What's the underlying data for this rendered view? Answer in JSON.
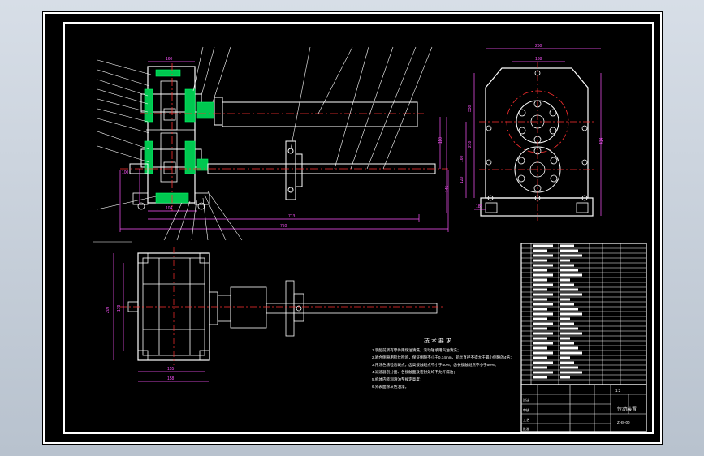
{
  "drawing": {
    "dimensions": {
      "gearbox_width_top": "160",
      "shaft_length": "713",
      "overall_length": "750",
      "base_width": "158",
      "side_width_top": "260",
      "side_width_inner": "168",
      "side_height": "414",
      "plan_width": "209",
      "plan_width_inner": "179",
      "plan_depth": "155",
      "side_offset": "185",
      "side_h1": "330",
      "side_h2": "210",
      "side_h3": "160",
      "side_h4": "120",
      "dim_110": "110",
      "dim_145": "145",
      "dim_100": "100",
      "gearbox_bottom": "104"
    },
    "tech_req_title": "技 术 要 求",
    "tech_req_lines": [
      "1.装配前所有零件用煤油清洗，滚动轴承用汽油清洗；",
      "2.啮合侧隙用铅丝检验，保证侧隙不小于0.14mm，铅丝直径不得大于最小侧隙的4倍；",
      "3.用涂色法检验斑点，齿高接触斑点不小于40%，齿长接触斑点不小于50%；",
      "4.减速器剖分面、各接触面及密封处均不允许漏油；",
      "5.机体内装润滑油至规定高度；",
      "6.外表面涂灰色油漆。"
    ],
    "title_block": {
      "name": "传动装置",
      "drawing_no": "ZHS-00",
      "scale": "1:2",
      "row_labels": [
        "设计",
        "审核",
        "工艺",
        "批准"
      ]
    }
  },
  "colors": {
    "background": "#000000",
    "outline": "#ffffff",
    "section_hatch": "#00ff66",
    "center_line": "#ff3030",
    "dimension": "#ff55ff",
    "leader": "#ffffff"
  }
}
